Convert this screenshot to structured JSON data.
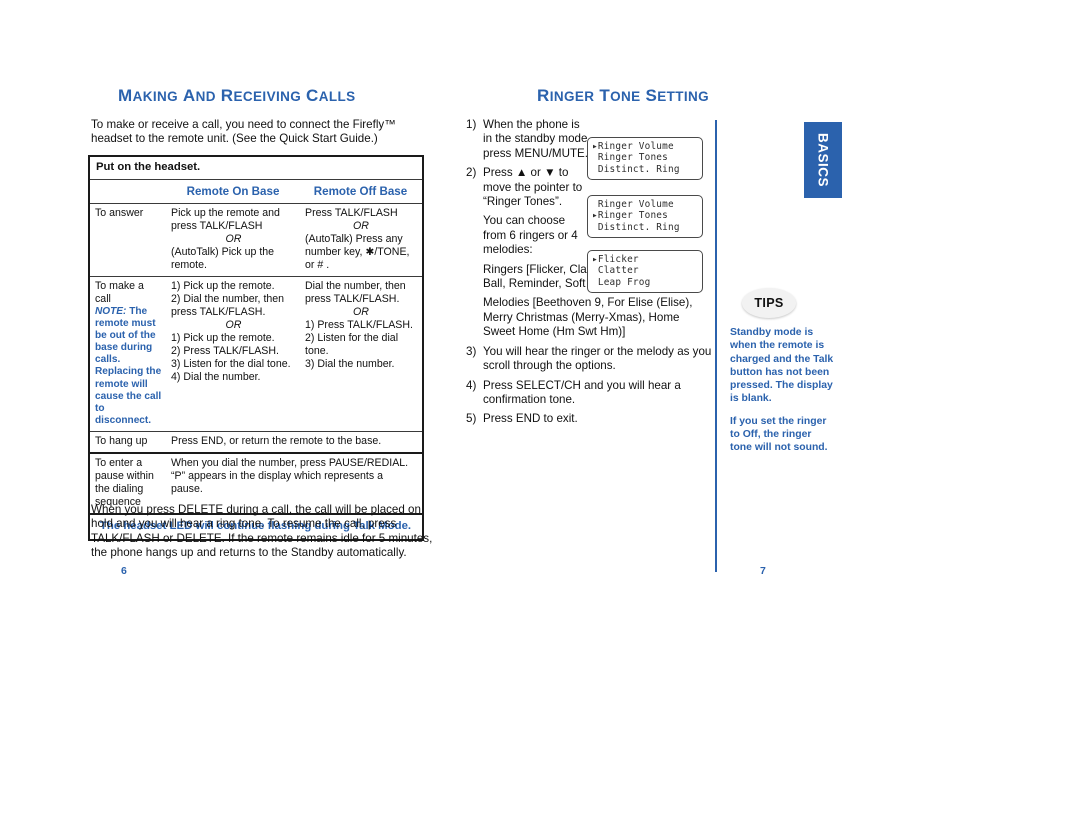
{
  "left_page": {
    "heading": {
      "part1_cap": "M",
      "part1_rest": "AKING",
      "and_cap": "A",
      "and_rest": "ND",
      "part2_cap": "R",
      "part2_rest": "ECEIVING",
      "part3_cap": "C",
      "part3_rest": "ALLS",
      "full": "MAKING AND RECEIVING CALLS"
    },
    "intro": "To make or receive a call, you need to connect the Firefly™ headset to the remote unit. (See the Quick Start Guide.)",
    "table": {
      "banner": "Put on the headset.",
      "col_headers": {
        "blank": "",
        "on_base": "Remote On Base",
        "off_base": "Remote Off Base"
      },
      "rows": [
        {
          "label": "To answer",
          "on_base": "Pick up the remote and press TALK/FLASH",
          "on_base_or": "OR",
          "on_base_2": "(AutoTalk) Pick up the remote.",
          "off_base": "Press TALK/FLASH",
          "off_base_or": "OR",
          "off_base_2": "(AutoTalk) Press any number key, ✱/TONE, or # ."
        },
        {
          "label": "To make a call",
          "note_lead": "NOTE:",
          "note": " The remote must be out of the base during calls. Replacing the remote will cause the call to disconnect.",
          "on_base_1": "1) Pick up the remote.",
          "on_base_2": "2) Dial the number, then press TALK/FLASH.",
          "on_base_or": "OR",
          "on_base_3": "1) Pick up the remote.",
          "on_base_4": "2) Press TALK/FLASH.",
          "on_base_5": "3) Listen for the dial tone.",
          "on_base_6": "4) Dial the number.",
          "off_base_1": "Dial the number, then press TALK/FLASH.",
          "off_base_or": "OR",
          "off_base_2": "1) Press TALK/FLASH.",
          "off_base_3": "2) Listen for the dial tone.",
          "off_base_4": "3) Dial the number."
        },
        {
          "label": "To hang up",
          "text": "Press END, or return the remote to the base."
        },
        {
          "label": "To enter a pause within the dialing sequence",
          "text": "When you dial the number, press PAUSE/REDIAL. “P” appears in the display which  represents a pause."
        }
      ],
      "footer": "The headset LED will continue flashing during Talk Mode."
    },
    "closing": "When you press DELETE during a call, the call will be placed on hold and you will hear a ring tone. To resume the call, press TALK/FLASH or DELETE. If the remote remains idle for 5 minutes, the phone hangs up and returns to the Standby automatically.",
    "page_number": "6"
  },
  "right_page": {
    "heading": {
      "full": "RINGER TONE SETTING"
    },
    "steps": [
      {
        "marker": "1)",
        "text": "When the phone is in the standby mode, press MENU/MUTE."
      },
      {
        "marker": "2)",
        "text": "Press ▲ or ▼ to move the pointer to “Ringer Tones”."
      },
      {
        "marker": "3)",
        "text": "You will hear the ringer or the melody as you scroll through the options."
      },
      {
        "marker": "4)",
        "text": "Press SELECT/CH and you will hear a confirmation tone."
      },
      {
        "marker": "5)",
        "text": "Press END to exit."
      }
    ],
    "choose_intro": "You can choose from 6 ringers or 4 melodies:",
    "ringers_list": "Ringers [Flicker, Clatter, Leap Frog, Ping Ball, Reminder, Soft Alert]",
    "melodies_list": "Melodies [Beethoven 9, For Elise (Elise), Merry Christmas (Merry-Xmas), Home Sweet Home (Hm Swt Hm)]",
    "lcd_displays": [
      {
        "name": "menu-display-ringer-volume",
        "lines": [
          "▸Ringer Volume",
          " Ringer Tones",
          " Distinct. Ring"
        ]
      },
      {
        "name": "menu-display-ringer-tones",
        "lines": [
          " Ringer Volume",
          "▸Ringer Tones",
          " Distinct. Ring"
        ]
      },
      {
        "name": "menu-display-ringer-list",
        "lines": [
          "▸Flicker",
          " Clatter",
          " Leap Frog"
        ]
      }
    ],
    "page_number": "7"
  },
  "sidebar": {
    "section_tab": "BASICS",
    "tips_badge": "TIPS",
    "tips": [
      "Standby mode is when the remote is charged and the Talk button has not been pressed. The display is blank.",
      "If you set the ringer to Off, the ringer tone will not sound."
    ]
  },
  "colors": {
    "accent_blue": "#2b62ad",
    "text_black": "#111111",
    "table_border": "#1a1a1a",
    "lcd_border": "#4a4a4a",
    "tips_badge_bg": "#f2f2f2"
  }
}
